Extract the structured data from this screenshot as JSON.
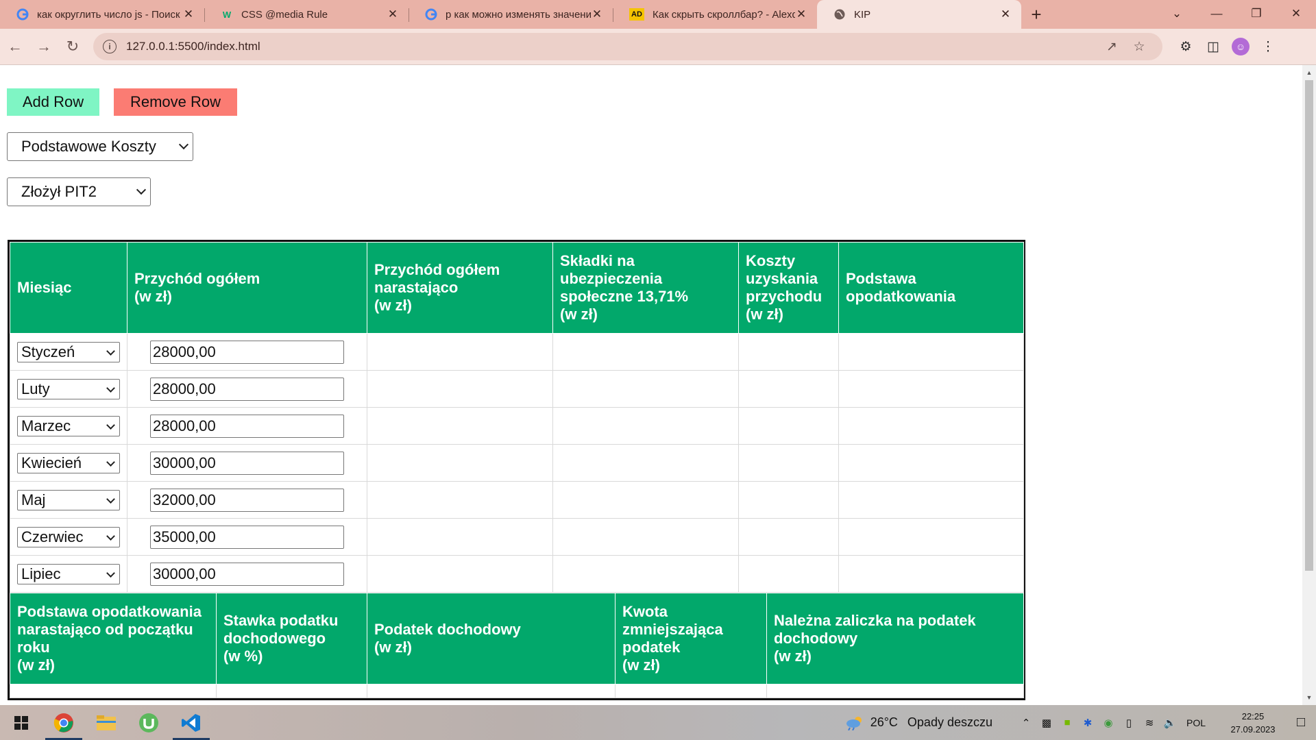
{
  "browser": {
    "tabs": [
      {
        "title": "как округлить число js - Поиск",
        "favicon": "google-favicon",
        "close": "✕"
      },
      {
        "title": "CSS @media Rule",
        "favicon": "w3schools-favicon",
        "close": "✕"
      },
      {
        "title": "р как можно изменять значени",
        "favicon": "google-favicon",
        "close": "✕"
      },
      {
        "title": "Как скрыть скроллбар? - Alexd",
        "favicon": "ad-favicon",
        "close": "✕"
      },
      {
        "title": "KIP",
        "favicon": "globe-favicon",
        "close": "✕"
      }
    ],
    "w3_letter": "W",
    "ad_letter": "AD",
    "url": "127.0.0.1:5500/index.html",
    "new_tab": "+"
  },
  "controls": {
    "add_row": "Add Row",
    "remove_row": "Remove Row",
    "koszty_selected": "Podstawowe Koszty",
    "pit_selected": "Złożył PIT2"
  },
  "table1": {
    "headers": [
      [
        "Miesiąc"
      ],
      [
        "Przychód ogółem",
        "(w zł)"
      ],
      [
        "Przychód ogółem",
        "narastająco",
        "(w zł)"
      ],
      [
        "Składki na",
        "ubezpieczenia",
        "społeczne 13,71%",
        "(w zł)"
      ],
      [
        "Koszty",
        "uzyskania",
        "przychodu",
        "(w zł)"
      ],
      [
        "Podstawa",
        "opodatkowania"
      ]
    ],
    "rows": [
      {
        "month": "Styczeń",
        "income": "28000,00"
      },
      {
        "month": "Luty",
        "income": "28000,00"
      },
      {
        "month": "Marzec",
        "income": "28000,00"
      },
      {
        "month": "Kwiecień",
        "income": "30000,00"
      },
      {
        "month": "Maj",
        "income": "32000,00"
      },
      {
        "month": "Czerwiec",
        "income": "35000,00"
      },
      {
        "month": "Lipiec",
        "income": "30000,00"
      }
    ]
  },
  "table2": {
    "headers": [
      [
        "Podstawa opodatkowania",
        "narastająco od początku",
        "roku",
        "(w zł)"
      ],
      [
        "Stawka podatku",
        "dochodowego",
        "(w %)"
      ],
      [
        "Podatek dochodowy",
        "(w zł)"
      ],
      [
        "Kwota",
        "zmniejszająca",
        "podatek",
        "(w zł)"
      ],
      [
        "Należna zaliczka na podatek",
        "dochodowy",
        "(w zł)"
      ]
    ]
  },
  "taskbar": {
    "temperature": "26°C",
    "weather": "Opady deszczu",
    "language": "POL",
    "time": "22:25",
    "date": "27.09.2023"
  },
  "colors": {
    "header_green": "#02a86b",
    "add_button": "#7ff5c4",
    "remove_button": "#fb7c73",
    "tabbar": "#e9b2a7"
  }
}
